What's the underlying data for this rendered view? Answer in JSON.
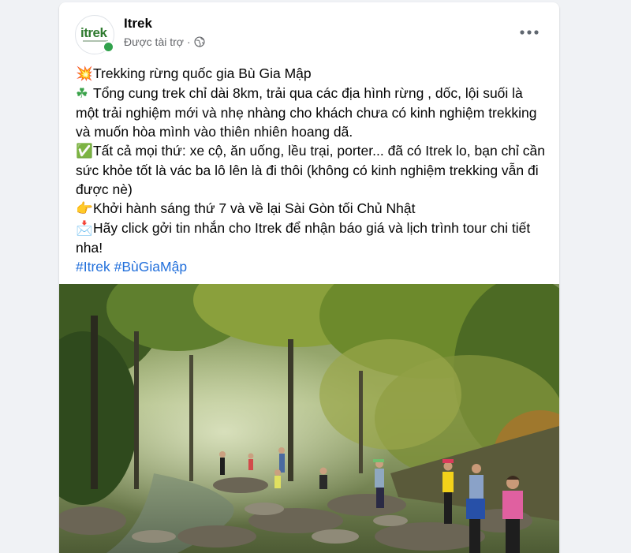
{
  "post": {
    "page_name": "Itrek",
    "avatar_logo_text": "itrek",
    "sponsored_label": "Được tài trợ",
    "separator": "·",
    "more_icon": "more-horizontal-icon",
    "lines": [
      {
        "icon": "💥",
        "icon_name": "collision-emoji-icon",
        "text": "Trekking rừng quốc gia Bù Gia Mập"
      },
      {
        "icon": "☘",
        "icon_name": "shamrock-emoji-icon",
        "text": "Tổng cung trek chỉ dài 8km, trải qua các địa hình rừng , dốc, lội suối là một trải nghiệm mới và nhẹ nhàng cho khách chưa có kinh nghiệm trekking và muốn hòa mình vào thiên nhiên hoang dã."
      },
      {
        "icon": "✅",
        "icon_name": "check-mark-emoji-icon",
        "text": "Tất cả mọi thứ: xe cộ, ăn uống, lều trại, porter... đã có Itrek lo, bạn chỉ cần sức khỏe tốt là vác ba lô lên là đi thôi (không có kinh nghiệm trekking vẫn đi được nè)"
      },
      {
        "icon": "👉",
        "icon_name": "pointing-hand-emoji-icon",
        "text": "Khởi hành sáng thứ 7 và về lại Sài Gòn tối Chủ Nhật"
      },
      {
        "icon": "📩",
        "icon_name": "inbox-tray-emoji-icon",
        "text": "Hãy click gởi tin nhắn cho Itrek để nhận báo giá và lịch trình tour chi tiết nha!"
      }
    ],
    "hashtags": [
      "#Itrek",
      "#BùGiaMập"
    ],
    "photo_alt_icon": "forest-stream-photo"
  }
}
